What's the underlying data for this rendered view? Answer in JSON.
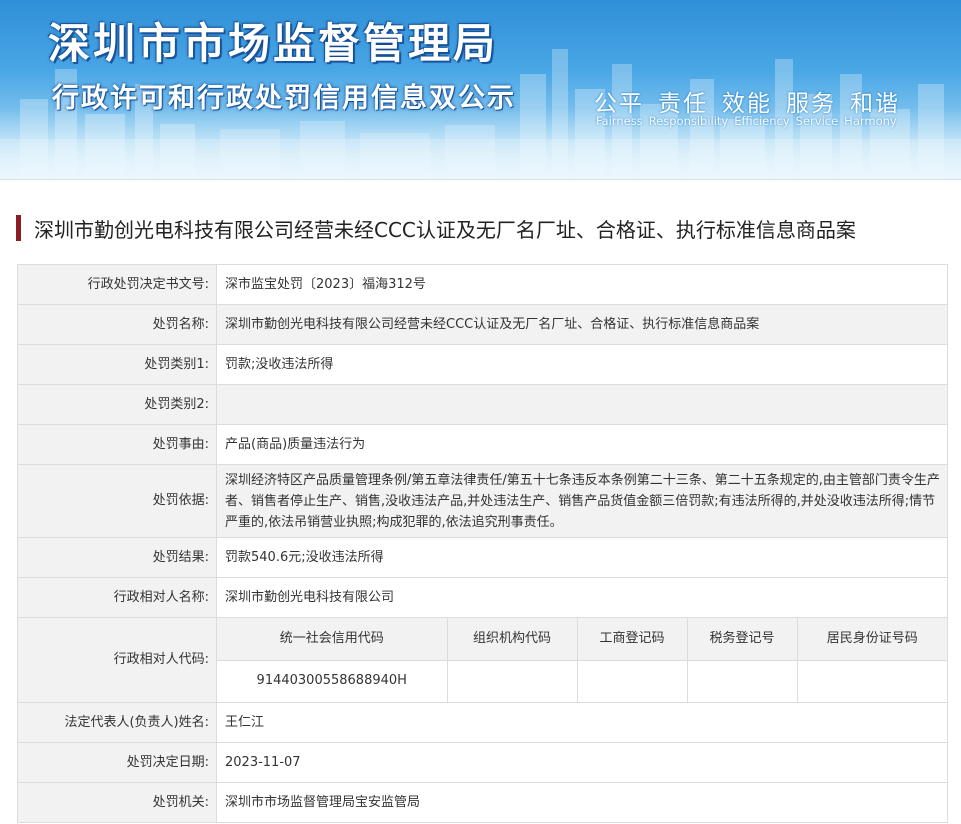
{
  "banner": {
    "title": "深圳市市场监督管理局",
    "subtitle": "行政许可和行政处罚信用信息双公示",
    "slogans": [
      {
        "cn": "公平",
        "en": "Fairness"
      },
      {
        "cn": "责任",
        "en": "Responsibility"
      },
      {
        "cn": "效能",
        "en": "Efficiency"
      },
      {
        "cn": "服务",
        "en": "Service"
      },
      {
        "cn": "和谐",
        "en": "Harmony"
      }
    ],
    "colors": {
      "sky_top": "#2f8fd6",
      "sky_bottom": "#d5ecf8",
      "title_text": "#ffffff"
    }
  },
  "case": {
    "title": "深圳市勤创光电科技有限公司经营未经CCC认证及无厂名厂址、合格证、执行标准信息商品案",
    "title_bar_color": "#8c1d24"
  },
  "fields": {
    "decision_no": {
      "label": "行政处罚决定书文号:",
      "value": "深市监宝处罚〔2023〕福海312号"
    },
    "penalty_name": {
      "label": "处罚名称:",
      "value": "深圳市勤创光电科技有限公司经营未经CCC认证及无厂名厂址、合格证、执行标准信息商品案"
    },
    "category1": {
      "label": "处罚类别1:",
      "value": "罚款;没收违法所得"
    },
    "category2": {
      "label": "处罚类别2:",
      "value": ""
    },
    "reason": {
      "label": "处罚事由:",
      "value": "产品(商品)质量违法行为"
    },
    "basis": {
      "label": "处罚依据:",
      "value": "深圳经济特区产品质量管理条例/第五章法律责任/第五十七条违反本条例第二十三条、第二十五条规定的,由主管部门责令生产者、销售者停止生产、销售,没收违法产品,并处违法生产、销售产品货值金额三倍罚款;有违法所得的,并处没收违法所得;情节严重的,依法吊销营业执照;构成犯罪的,依法追究刑事责任。"
    },
    "result": {
      "label": "处罚结果:",
      "value": "罚款540.6元;没收违法所得"
    },
    "party_name": {
      "label": "行政相对人名称:",
      "value": "深圳市勤创光电科技有限公司"
    },
    "party_code": {
      "label": "行政相对人代码:",
      "headers": [
        "统一社会信用代码",
        "组织机构代码",
        "工商登记码",
        "税务登记号",
        "居民身份证号码"
      ],
      "values": [
        "91440300558688940H",
        "",
        "",
        "",
        ""
      ]
    },
    "legal_rep": {
      "label": "法定代表人(负责人)姓名:",
      "value": "王仁江"
    },
    "decision_date": {
      "label": "处罚决定日期:",
      "value": "2023-11-07"
    },
    "authority": {
      "label": "处罚机关:",
      "value": "深圳市市场监督管理局宝安监管局"
    }
  }
}
